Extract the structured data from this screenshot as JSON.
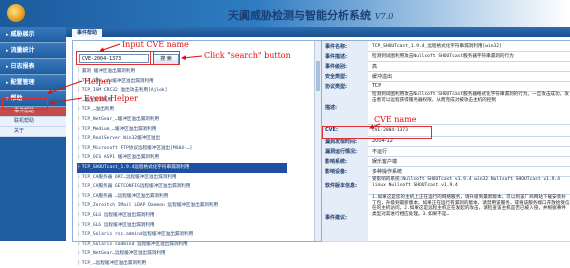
{
  "app": {
    "title": "天阗威胁检测与智能分析系统",
    "version": "V7.0"
  },
  "sidebar": {
    "items": [
      {
        "label": "威胁展示"
      },
      {
        "label": "流量统计"
      },
      {
        "label": "日志报表"
      },
      {
        "label": "配置管理"
      },
      {
        "label": "帮助"
      }
    ],
    "sub_items": [
      {
        "label": "事件帮助"
      },
      {
        "label": "联机帮助"
      },
      {
        "label": "关于"
      }
    ]
  },
  "tab": {
    "label": "事件帮助"
  },
  "search": {
    "value": "CVE-2004-1373",
    "button_label": "搜 索"
  },
  "vuln_list": [
    "漏洞 缓冲区溢出漏洞利用",
    "TCP_IMS…cf…缓冲区溢出漏洞利用",
    "TCP_ISM CRC32 溢出攻击利用[Ajlok]",
    "…溢出漏洞利用",
    "TCP_…溢出利用",
    "TCP_NetGear_…缓冲区溢出漏洞利用",
    "TCP_Medium_…缓冲区溢出漏洞利用",
    "TCP_RealServer Win32缓冲区溢出",
    "TCP_Microsoft FTP协议远程缓冲区溢出[MS04-…]",
    "TCP_OCS ASP1 缓冲区溢出漏洞利用",
    "TCP_SHOUTcast_1.9.4远程格式化字符串漏洞利用",
    "TCP_CA服务器 ORT…远程缓冲区溢出漏洞利用",
    "TCP_CA服务器 GETCONFIG远程缓冲区溢出漏洞利用",
    "TCP_CA服务器 …远程缓冲区溢出漏洞利用",
    "TCP_Zeroitch IMail LDAP Daemon 远程缓冲区溢出漏洞利用",
    "TCP_GLG 远程缓冲区溢出漏洞利用",
    "TCP_GLG 远程缓冲区溢出漏洞利用",
    "TCP_Solaris rsc.admind远程缓冲区溢出漏洞利用",
    "TCP_Solaris sadmind 远程缓冲区溢出漏洞利用",
    "TCP_NetGear…远程缓冲区溢出漏洞利用",
    "TCP_…远程缓冲区溢出漏洞利用"
  ],
  "selected_index": 10,
  "detail": {
    "rows": [
      {
        "label": "事件名称:",
        "value": "TCP_SHOUTcast_1.9.4_远程格式化字符串漏洞利用[win32]"
      },
      {
        "label": "事件描述:",
        "value": "检测到试图利用攻击Nullsoft SHOUTcast服务器字符串漏洞的行为"
      },
      {
        "label": "事件级别:",
        "value": "高"
      },
      {
        "label": "安全类型:",
        "value": "缓冲溢出"
      },
      {
        "label": "协议类型:",
        "value": "TCP"
      },
      {
        "label": "描述:",
        "value": "检测到试图利用攻击Nullsoft SHOUTcast服务器格式化字符串漏洞的行为。一旦攻击成功，攻击者可以远程获得服务器权限，从而完成对被攻击主机的控制"
      },
      {
        "label": "CVE:",
        "value": "CVE-2004-1373"
      },
      {
        "label": "漏洞发现时间:",
        "value": "2004-12"
      },
      {
        "label": "漏洞运行情况:",
        "value": "不运行"
      },
      {
        "label": "影响系统:",
        "value": "娱乐客户端"
      },
      {
        "label": "影响设备:",
        "value": "多种操作系统"
      },
      {
        "label": "软件版本信息:",
        "value": "受影响的系统:Nullsoft SHOUTcast v1.9.4 win32 Nullsoft SHOUTcast v1.9.4 linux Nullsoft SHOUTcast v1.9.4"
      },
      {
        "label": "事件建议:",
        "value": "1.如果这是您的主机上正在运行的网络服务，请升级到最新版本，可以到该厂商网站下载安装补丁包，升级到最新版本。如果正在运行有漏洞的版本，请禁用该服务，或将该服务端口开放给受信任的主机访问。2.如果这是远程主机正在发起的攻击，请检查该主机是否已被入侵，并根据事件类型对其进行相应处理。3.如果不是…"
      }
    ]
  },
  "annotations": {
    "input_label": "Input CVE name",
    "click_label": "Click \"search\" button",
    "helper_label": "Helper",
    "event_helper_label": "Event Helper",
    "cve_label": "CVE name"
  }
}
